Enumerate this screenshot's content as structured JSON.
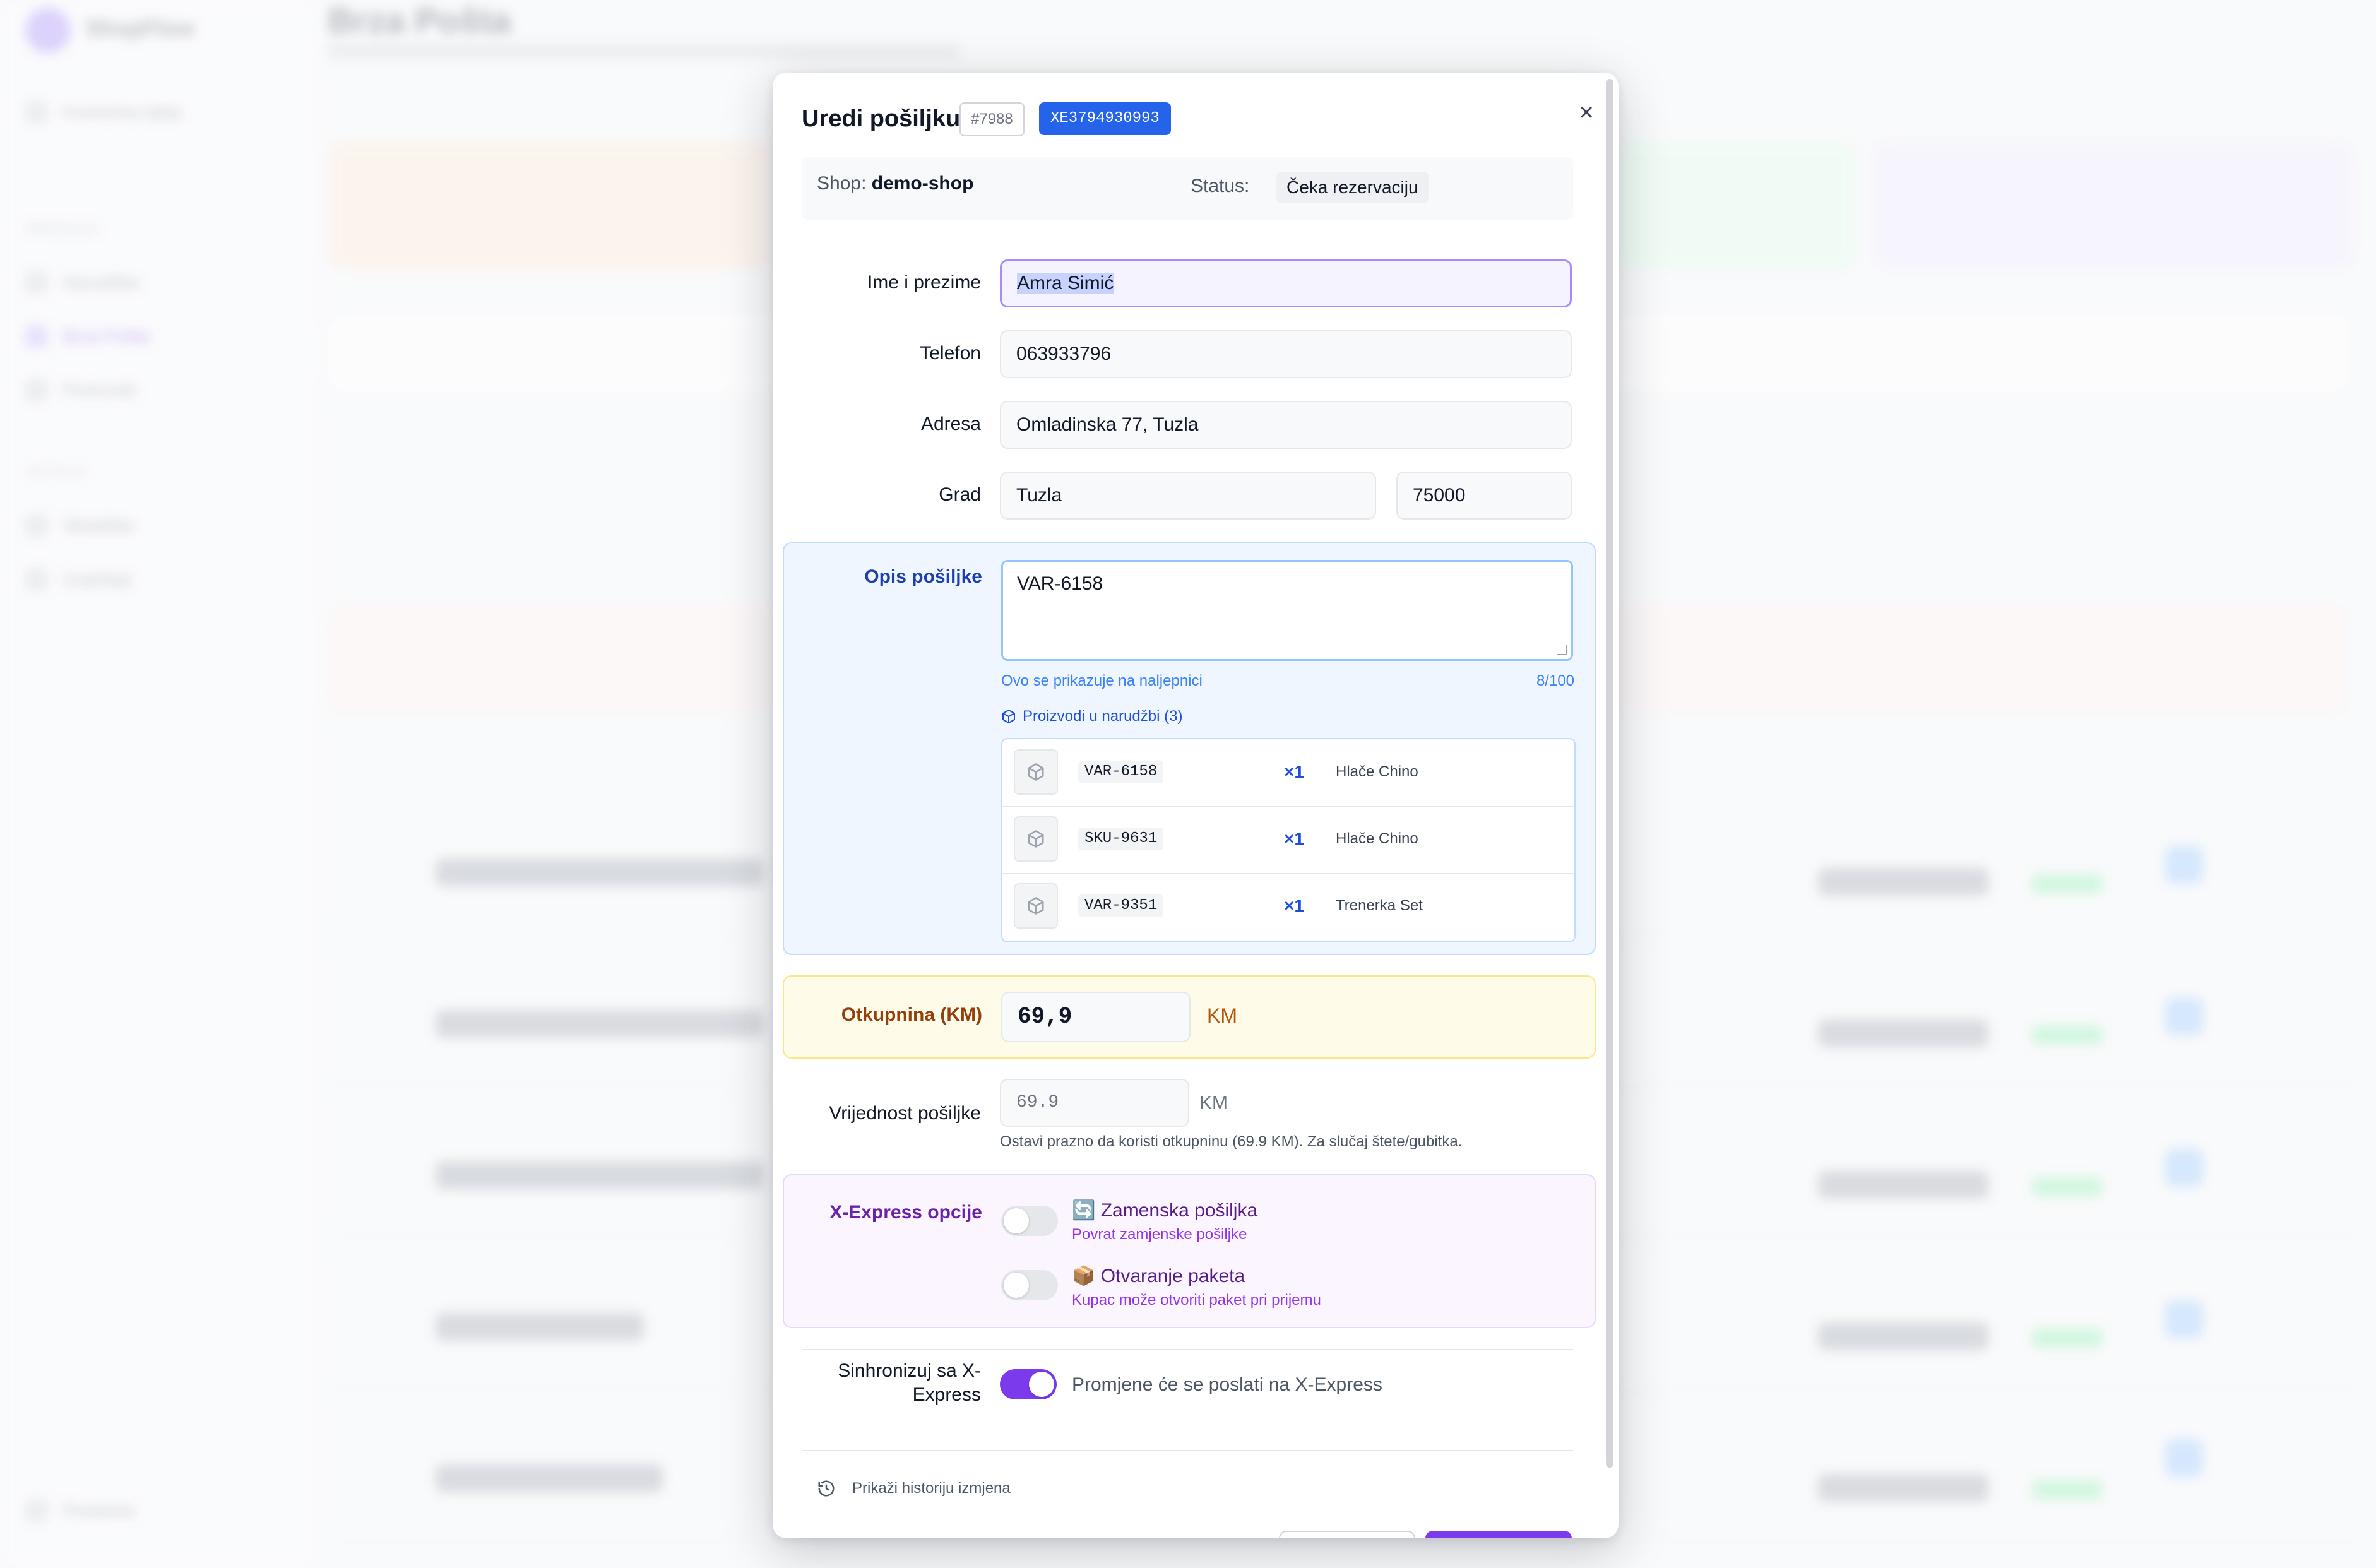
{
  "background": {
    "app_name": "ShopFlow",
    "page_title": "Brza Pošta",
    "nav": [
      "Kontrolna tabla",
      "Narudžbe",
      "Brza Pošta",
      "Proizvodi",
      "Skladište",
      "Izvještaji",
      "Postavke"
    ]
  },
  "modal": {
    "title": "Uredi pošiljku",
    "order_id": "#7988",
    "tracking_code": "XE3794930993",
    "close_label": "×",
    "shop_label": "Shop:",
    "shop_value": "demo-shop",
    "status_label": "Status:",
    "status_value": "Čeka rezervaciju",
    "fields": {
      "name_label": "Ime i prezime",
      "name_value": "Amra Simić",
      "phone_label": "Telefon",
      "phone_value": "063933796",
      "address_label": "Adresa",
      "address_value": "Omladinska 77, Tuzla",
      "city_label": "Grad",
      "city_value": "Tuzla",
      "postal_value": "75000"
    },
    "description": {
      "label": "Opis pošiljke",
      "value": "VAR-6158",
      "hint": "Ovo se prikazuje na naljepnici",
      "counter": "8/100",
      "products_heading": "Proizvodi u narudžbi (3)",
      "products": [
        {
          "sku": "VAR-6158",
          "qty": "×1",
          "name": "Hlače Chino"
        },
        {
          "sku": "SKU-9631",
          "qty": "×1",
          "name": "Hlače Chino"
        },
        {
          "sku": "VAR-9351",
          "qty": "×1",
          "name": "Trenerka Set"
        }
      ]
    },
    "cod": {
      "label": "Otkupnina (KM)",
      "value": "69,9",
      "unit": "KM"
    },
    "value_field": {
      "label": "Vrijednost pošiljke",
      "placeholder": "69.9",
      "unit": "KM",
      "hint": "Ostavi prazno da koristi otkupninu (69.9 KM). Za slučaj štete/gubitka."
    },
    "xexpress": {
      "label": "X-Express opcije",
      "options": [
        {
          "icon": "🔄",
          "title": "Zamenska pošiljka",
          "subtitle": "Povrat zamjenske pošiljke",
          "enabled": false
        },
        {
          "icon": "📦",
          "title": "Otvaranje paketa",
          "subtitle": "Kupac može otvoriti paket pri prijemu",
          "enabled": false
        }
      ]
    },
    "sync": {
      "label": "Sinhronizuj sa X-Express",
      "text": "Promjene će se poslati na X-Express",
      "enabled": true
    },
    "history_link": "Prikaži historiju izmjena"
  },
  "colors": {
    "accent": "#7c3aed",
    "tracking_badge": "#2563eb",
    "description_bg": "#eff6ff",
    "cod_bg": "#fefce8",
    "xexpress_bg": "#faf5ff"
  }
}
